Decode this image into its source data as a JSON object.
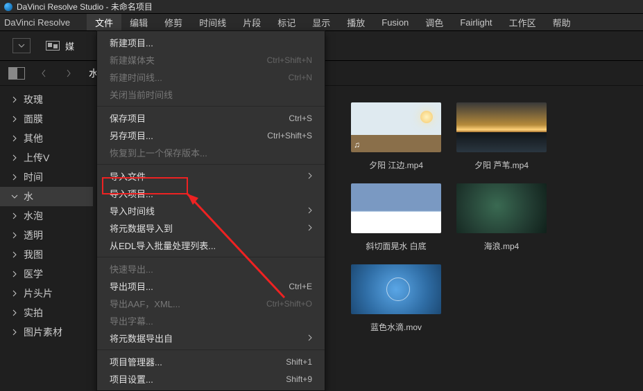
{
  "title": {
    "app": "DaVinci Resolve Studio",
    "project": "未命名项目"
  },
  "menubar": {
    "app_name": "DaVinci Resolve",
    "items": [
      "文件",
      "编辑",
      "修剪",
      "时间线",
      "片段",
      "标记",
      "显示",
      "播放",
      "Fusion",
      "调色",
      "Fairlight",
      "工作区",
      "帮助"
    ],
    "active_index": 0
  },
  "toolbar": {
    "media_tab": "媒"
  },
  "subbar": {
    "path": "水"
  },
  "sidebar": {
    "items": [
      {
        "label": "玫瑰",
        "expanded": false
      },
      {
        "label": "面膜",
        "expanded": false
      },
      {
        "label": "其他",
        "expanded": false
      },
      {
        "label": "上传V",
        "expanded": false
      },
      {
        "label": "时间",
        "expanded": false
      },
      {
        "label": "水",
        "expanded": true,
        "hover": true
      },
      {
        "label": "水泡",
        "expanded": false
      },
      {
        "label": "透明",
        "expanded": false
      },
      {
        "label": "我图",
        "expanded": false
      },
      {
        "label": "医学",
        "expanded": false
      },
      {
        "label": "片头片",
        "expanded": false
      },
      {
        "label": "实拍",
        "expanded": false
      },
      {
        "label": "图片素材",
        "expanded": false
      }
    ]
  },
  "dropdown": {
    "groups": [
      [
        {
          "label": "新建项目..."
        },
        {
          "label": "新建媒体夹",
          "shortcut": "Ctrl+Shift+N",
          "disabled": true
        },
        {
          "label": "新建时间线...",
          "shortcut": "Ctrl+N",
          "disabled": true
        },
        {
          "label": "关闭当前时间线",
          "disabled": true
        }
      ],
      [
        {
          "label": "保存项目",
          "shortcut": "Ctrl+S"
        },
        {
          "label": "另存项目...",
          "shortcut": "Ctrl+Shift+S"
        },
        {
          "label": "恢复到上一个保存版本...",
          "disabled": true
        }
      ],
      [
        {
          "label": "导入文件",
          "submenu": true,
          "highlight": true
        },
        {
          "label": "导入项目..."
        },
        {
          "label": "导入时间线",
          "submenu": true
        },
        {
          "label": "将元数据导入到",
          "submenu": true
        },
        {
          "label": "从EDL导入批量处理列表..."
        }
      ],
      [
        {
          "label": "快速导出...",
          "disabled": true
        },
        {
          "label": "导出项目...",
          "shortcut": "Ctrl+E"
        },
        {
          "label": "导出AAF，XML...",
          "shortcut": "Ctrl+Shift+O",
          "disabled": true
        },
        {
          "label": "导出字幕...",
          "disabled": true
        },
        {
          "label": "将元数据导出自",
          "submenu": true
        }
      ],
      [
        {
          "label": "项目管理器...",
          "shortcut": "Shift+1"
        },
        {
          "label": "项目设置...",
          "shortcut": "Shift+9"
        }
      ]
    ]
  },
  "media": {
    "clips": [
      {
        "name": "夕阳 江边.mp4",
        "thumb": "t1",
        "audio": true
      },
      {
        "name": "夕阳 芦苇.mp4",
        "thumb": "t2"
      },
      {
        "name": "斜切面晃水 白底",
        "thumb": "t3"
      },
      {
        "name": "海浪.mp4",
        "thumb": "t4"
      },
      {
        "name": "蓝色水滴.mov",
        "thumb": "t5"
      }
    ]
  }
}
